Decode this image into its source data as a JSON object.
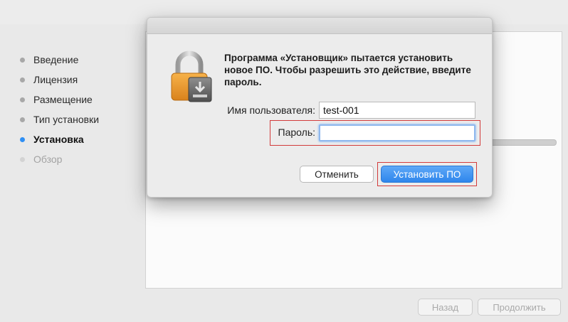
{
  "sidebar": {
    "steps": [
      {
        "label": "Введение"
      },
      {
        "label": "Лицензия"
      },
      {
        "label": "Размещение"
      },
      {
        "label": "Тип установки"
      },
      {
        "label": "Установка",
        "state": "current"
      },
      {
        "label": "Обзор",
        "state": "future"
      }
    ]
  },
  "footer": {
    "back_label": "Назад",
    "continue_label": "Продолжить"
  },
  "progress": {
    "fraction": 0.45
  },
  "dialog": {
    "message": "Программа «Установщик» пытается установить новое ПО. Чтобы разрешить это действие, введите пароль.",
    "username_label": "Имя пользователя:",
    "username_value": "test-001",
    "password_label": "Пароль:",
    "password_value": "",
    "cancel_label": "Отменить",
    "install_label": "Установить ПО",
    "icon": "lock-icon"
  },
  "colors": {
    "accent": "#2f8ff4",
    "highlight": "#d23b3b"
  }
}
